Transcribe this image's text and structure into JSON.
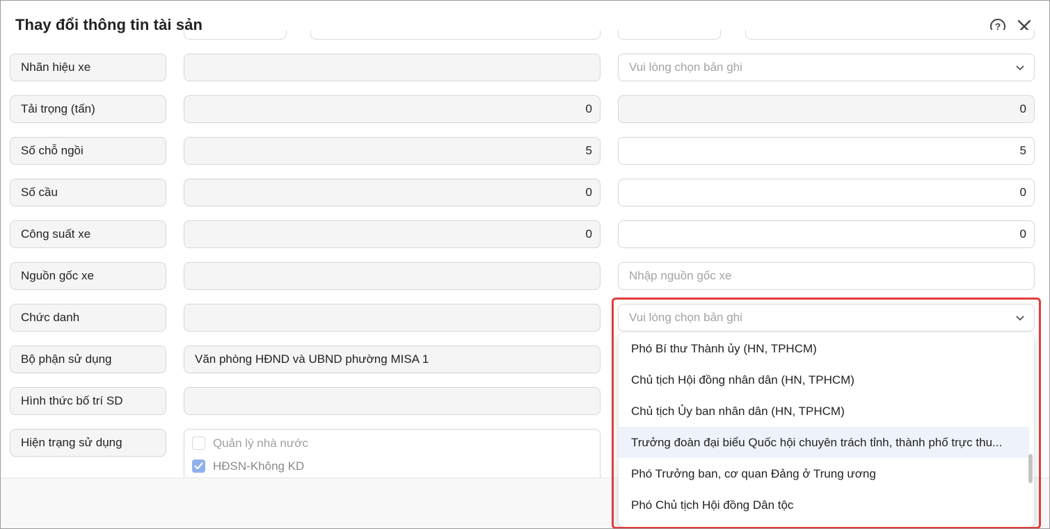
{
  "dialog": {
    "title": "Thay đổi thông tin tài sản"
  },
  "rows": [
    {
      "label": "Nhãn hiệu xe",
      "old_value": "",
      "new_placeholder": "Vui lòng chọn bản ghi",
      "new_type": "select"
    },
    {
      "label": "Tải trọng (tấn)",
      "old_value": "0",
      "new_value": "0",
      "new_type": "disabled"
    },
    {
      "label": "Số chỗ ngồi",
      "old_value": "5",
      "new_value": "5",
      "new_type": "input"
    },
    {
      "label": "Số cầu",
      "old_value": "0",
      "new_value": "0",
      "new_type": "input"
    },
    {
      "label": "Công suất xe",
      "old_value": "0",
      "new_value": "0",
      "new_type": "input"
    },
    {
      "label": "Nguồn gốc xe",
      "old_value": "",
      "new_placeholder": "Nhập nguồn gốc xe",
      "new_type": "input"
    },
    {
      "label": "Chức danh",
      "old_value": "",
      "new_placeholder": "Vui lòng chọn bản ghi",
      "new_type": "select"
    },
    {
      "label": "Bộ phận sử dụng",
      "old_value": "Văn phòng HĐND và UBND phường MISA 1"
    },
    {
      "label": "Hình thức bố trí SD",
      "old_value": ""
    },
    {
      "label": "Hiện trạng sử dụng"
    }
  ],
  "usage_status": [
    {
      "label": "Quản lý nhà nước",
      "checked": false
    },
    {
      "label": "HĐSN-Không KD",
      "checked": true
    }
  ],
  "dropdown": {
    "options": [
      "Phó Bí thư Thành ủy (HN, TPHCM)",
      "Chủ tịch Hội đồng nhân dân (HN, TPHCM)",
      "Chủ tịch Ủy ban nhân dân (HN, TPHCM)",
      "Trưởng đoàn đại biểu Quốc hội chuyên trách tỉnh, thành phố trực thu...",
      "Phó Trưởng ban, cơ quan Đảng ở Trung ương",
      "Phó Chủ tịch Hội đồng Dân tộc"
    ],
    "hovered_index": 3
  },
  "icons": {
    "help": "help-circle-icon",
    "help_glyph": "?",
    "close": "close-icon",
    "chevron": "chevron-down-icon",
    "check": "check-icon"
  },
  "colors": {
    "highlight_border": "#e23c3c",
    "checkbox_checked": "#8fb0ec",
    "option_hover": "#eef3fb"
  }
}
